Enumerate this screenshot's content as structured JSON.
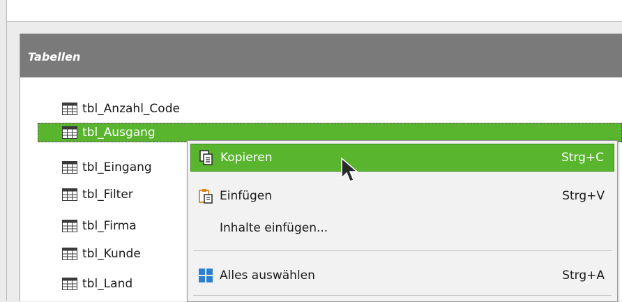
{
  "panel": {
    "title": "Tabellen"
  },
  "tables": [
    {
      "label": "tbl_Anzahl_Code",
      "selected": false
    },
    {
      "label": "tbl_Ausgang",
      "selected": true
    },
    {
      "label": "tbl_Eingang",
      "selected": false
    },
    {
      "label": "tbl_Filter",
      "selected": false
    },
    {
      "label": "tbl_Firma",
      "selected": false
    },
    {
      "label": "tbl_Kunde",
      "selected": false
    },
    {
      "label": "tbl_Land",
      "selected": false
    }
  ],
  "context_menu": {
    "items": [
      {
        "label": "Kopieren",
        "shortcut": "Strg+C",
        "icon": "copy-icon"
      },
      {
        "label": "Einfügen",
        "shortcut": "Strg+V",
        "icon": "paste-icon"
      },
      {
        "label": "Inhalte einfügen...",
        "shortcut": ""
      },
      {
        "label": "Alles auswählen",
        "shortcut": "Strg+A",
        "icon": "select-all-icon"
      }
    ]
  },
  "colors": {
    "accent": "#58b52d",
    "header": "#7a7a7a"
  }
}
